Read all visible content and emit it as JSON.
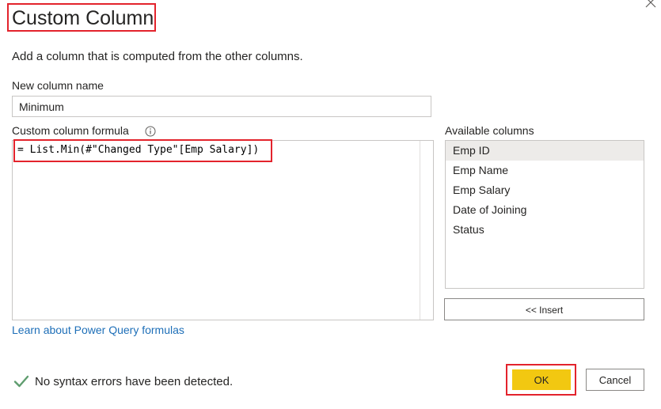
{
  "dialog": {
    "title": "Custom Column",
    "subtitle": "Add a column that is computed from the other columns."
  },
  "name_field": {
    "label": "New column name",
    "value": "Minimum"
  },
  "formula": {
    "label": "Custom column formula",
    "value": "= List.Min(#\"Changed Type\"[Emp Salary])"
  },
  "available_columns": {
    "label": "Available columns",
    "items": [
      {
        "label": "Emp ID",
        "selected": true
      },
      {
        "label": "Emp Name",
        "selected": false
      },
      {
        "label": "Emp Salary",
        "selected": false
      },
      {
        "label": "Date of Joining",
        "selected": false
      },
      {
        "label": "Status",
        "selected": false
      }
    ],
    "insert_label": "<< Insert"
  },
  "learn_link": "Learn about Power Query formulas",
  "status": {
    "text": "No syntax errors have been detected.",
    "icon": "checkmark-icon"
  },
  "buttons": {
    "ok_label": "OK",
    "cancel_label": "Cancel"
  },
  "colors": {
    "accent_yellow": "#f2c811",
    "link_blue": "#1e6fb8",
    "highlight_red": "#e3232c",
    "check_green": "#5f9d6f",
    "selected_bg": "#edebe9"
  }
}
